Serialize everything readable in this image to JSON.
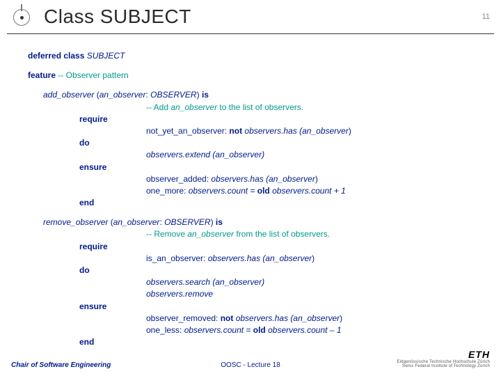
{
  "page_number": "11",
  "header": {
    "title": "Class SUBJECT"
  },
  "decl": {
    "deferred_kw": "deferred class",
    "class_name": "SUBJECT",
    "feature_kw": "feature",
    "feature_comment": "-- Observer pattern"
  },
  "add": {
    "name": "add_observer",
    "sig_open": " (",
    "param": "an_observer",
    "colon": ": ",
    "ptype": "OBSERVER",
    "sig_close": ") ",
    "is_kw": "is",
    "comment_a": "-- Add ",
    "comment_b": "an_observer",
    "comment_c": " to the list of observers.",
    "require_kw": "require",
    "pre_tag": "not_yet_an_observer: ",
    "pre_not": "not",
    "pre_expr": " observers.has (",
    "pre_arg": "an_observer",
    "pre_close": ")",
    "do_kw": "do",
    "body_a": "observers.extend (",
    "body_arg": "an_observer",
    "body_close": ")",
    "ensure_kw": "ensure",
    "post1_tag": "observer_added: ",
    "post1_expr": "observers.has (",
    "post1_arg": "an_observer",
    "post1_close": ")",
    "post2_tag": "one_more: ",
    "post2_a": "observers.count = ",
    "post2_old": "old",
    "post2_b": " observers.count + 1",
    "end_kw": "end"
  },
  "remove": {
    "name": "remove_observer",
    "sig_open": " (",
    "param": "an_observer",
    "colon": ": ",
    "ptype": "OBSERVER",
    "sig_close": ") ",
    "is_kw": "is",
    "comment_a": "-- Remove ",
    "comment_b": "an_observer",
    "comment_c": " from the list of observers.",
    "require_kw": "require",
    "pre_tag": "is_an_observer: ",
    "pre_expr": "observers.has (",
    "pre_arg": "an_observer",
    "pre_close": ")",
    "do_kw": "do",
    "body1_a": "observers.search (",
    "body1_arg": "an_observer",
    "body1_close": ")",
    "body2": "observers.remove",
    "ensure_kw": "ensure",
    "post1_tag": "observer_removed: ",
    "post1_not": "not",
    "post1_expr": " observers.has (",
    "post1_arg": "an_observer",
    "post1_close": ")",
    "post2_tag": "one_less: ",
    "post2_a": "observers.count = ",
    "post2_old": "old",
    "post2_b": " observers.count – 1",
    "end_kw": "end"
  },
  "footer": {
    "chair": "Chair of Software Engineering",
    "lecture": "OOSC - Lecture 18",
    "eth": "ETH",
    "eth_sub1": "Eidgenössische Technische Hochschule Zürich",
    "eth_sub2": "Swiss Federal Institute of Technology Zurich"
  }
}
